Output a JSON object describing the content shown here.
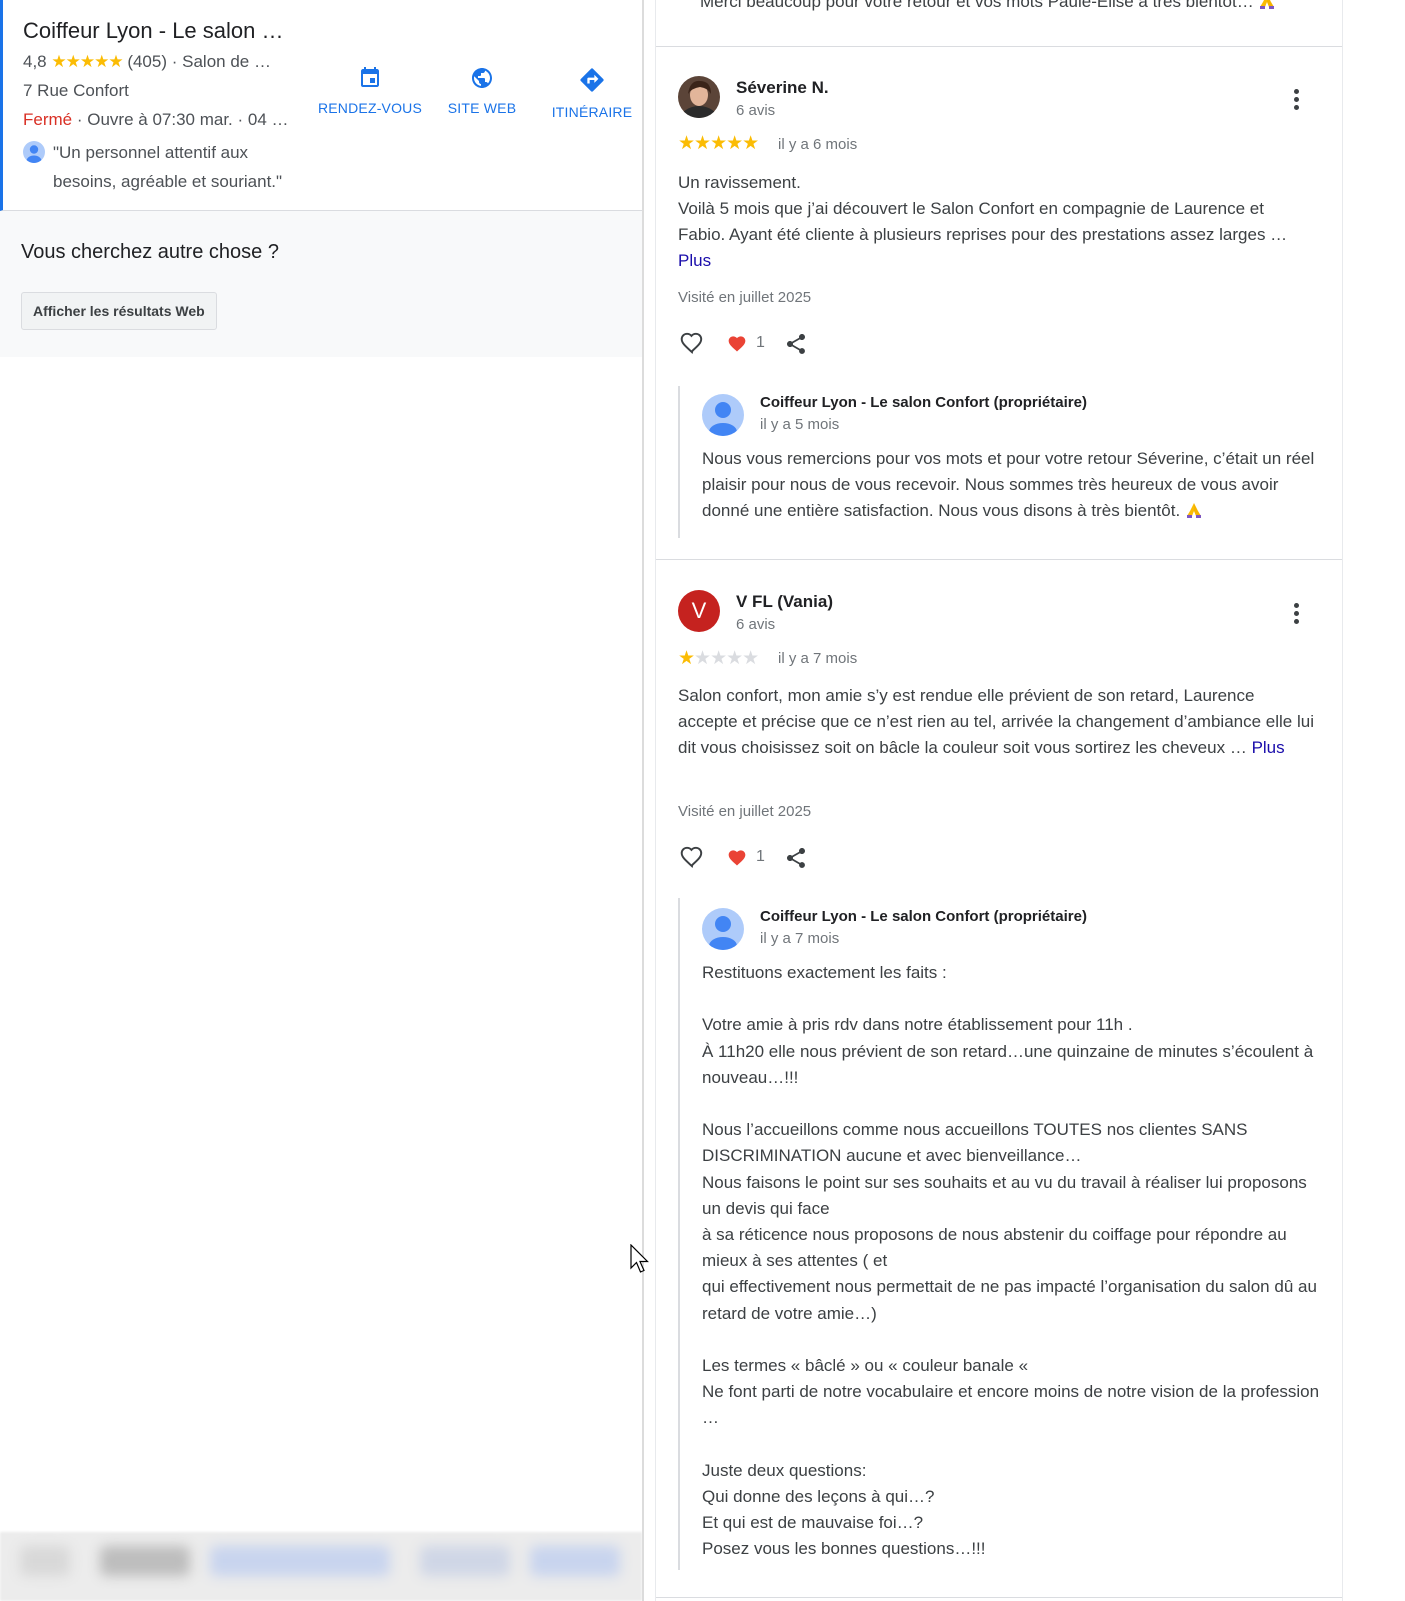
{
  "left_panel": {
    "business": {
      "title": "Coiffeur Lyon - Le salon …",
      "rating": "4,8",
      "stars": "★★★★★",
      "reviews": "(405)",
      "category": "· Salon de …",
      "address": "7 Rue Confort",
      "status": "Fermé",
      "hours": "· Ouvre à 07:30 mar. · 04 …",
      "quote": "\"Un personnel attentif aux besoins, agréable et souriant.\""
    },
    "actions": {
      "appointment": "RENDEZ-VOUS",
      "website": "SITE WEB",
      "directions": "ITINÉRAIRE"
    },
    "other": {
      "heading": "Vous cherchez autre chose ?",
      "button": "Afficher les résultats Web"
    }
  },
  "right_panel": {
    "previous_reply_tail": "Merci beaucoup pour votre retour et vos mots Paule-Elise à très bientôt…",
    "reviews": [
      {
        "name": "Séverine N.",
        "count": "6 avis",
        "rating": 5,
        "stars_on": "★★★★★",
        "stars_off": "",
        "date": "il y a 6 mois",
        "text": "Un ravissement.\nVoilà 5 mois que j’ai découvert le Salon Confort en compagnie de Laurence et Fabio. Ayant été cliente à plusieurs reprises pour des prestations assez larges …",
        "more": "Plus",
        "visit": "Visité en juillet 2025",
        "likes": "1",
        "reply": {
          "owner": "Coiffeur Lyon - Le salon Confort (propriétaire)",
          "date": "il y a 5 mois",
          "text": "Nous vous remercions pour vos mots et pour votre retour Séverine, c’était un réel plaisir pour nous de vous recevoir. Nous sommes très heureux de vous avoir donné une entière satisfaction. Nous vous disons à très bientôt."
        }
      },
      {
        "name": "V FL (Vania)",
        "initial": "V",
        "count": "6 avis",
        "rating": 1,
        "stars_on": "★",
        "stars_off": "★★★★",
        "date": "il y a 7 mois",
        "text": "Salon confort, mon amie s’y est rendue elle prévient de son retard, Laurence accepte et précise que ce n’est rien au tel, arrivée la changement d’ambiance elle lui dit vous choisissez soit on bâcle la couleur soit vous sortirez les cheveux …",
        "more": "Plus",
        "visit": "Visité en juillet 2025",
        "likes": "1",
        "reply": {
          "owner": "Coiffeur Lyon - Le salon Confort (propriétaire)",
          "date": "il y a 7 mois",
          "text": "Restituons exactement les faits :\n\nVotre amie à pris rdv dans notre établissement pour 11h .\nÀ 11h20 elle nous prévient de son retard…une quinzaine de minutes s’écoulent à nouveau…!!!\n\nNous l’accueillons comme nous accueillons TOUTES nos clientes SANS DISCRIMINATION aucune et avec bienveillance…\nNous faisons le point sur ses souhaits et au vu du travail à réaliser lui proposons un devis qui face\nà sa réticence nous proposons de nous abstenir du coiffage pour répondre au mieux à ses attentes ( et\nqui effectivement nous permettait de ne pas impacté l’organisation du salon dû au retard de votre amie…)\n\nLes termes « bâclé » ou « couleur banale «\nNe font parti de notre vocabulaire et encore moins de notre vision de la profession …\n\nJuste deux questions:\nQui donne des leçons à qui…?\nEt qui est de mauvaise foi…?\nPosez vous les bonnes questions…!!!"
        }
      }
    ]
  },
  "colors": {
    "accent_blue": "#1a73e8",
    "closed_red": "#d93025",
    "star_yellow": "#fbbc04",
    "more_link": "#1a0dab",
    "heart_red": "#ea4335",
    "avatar_v": "#c5221f"
  }
}
